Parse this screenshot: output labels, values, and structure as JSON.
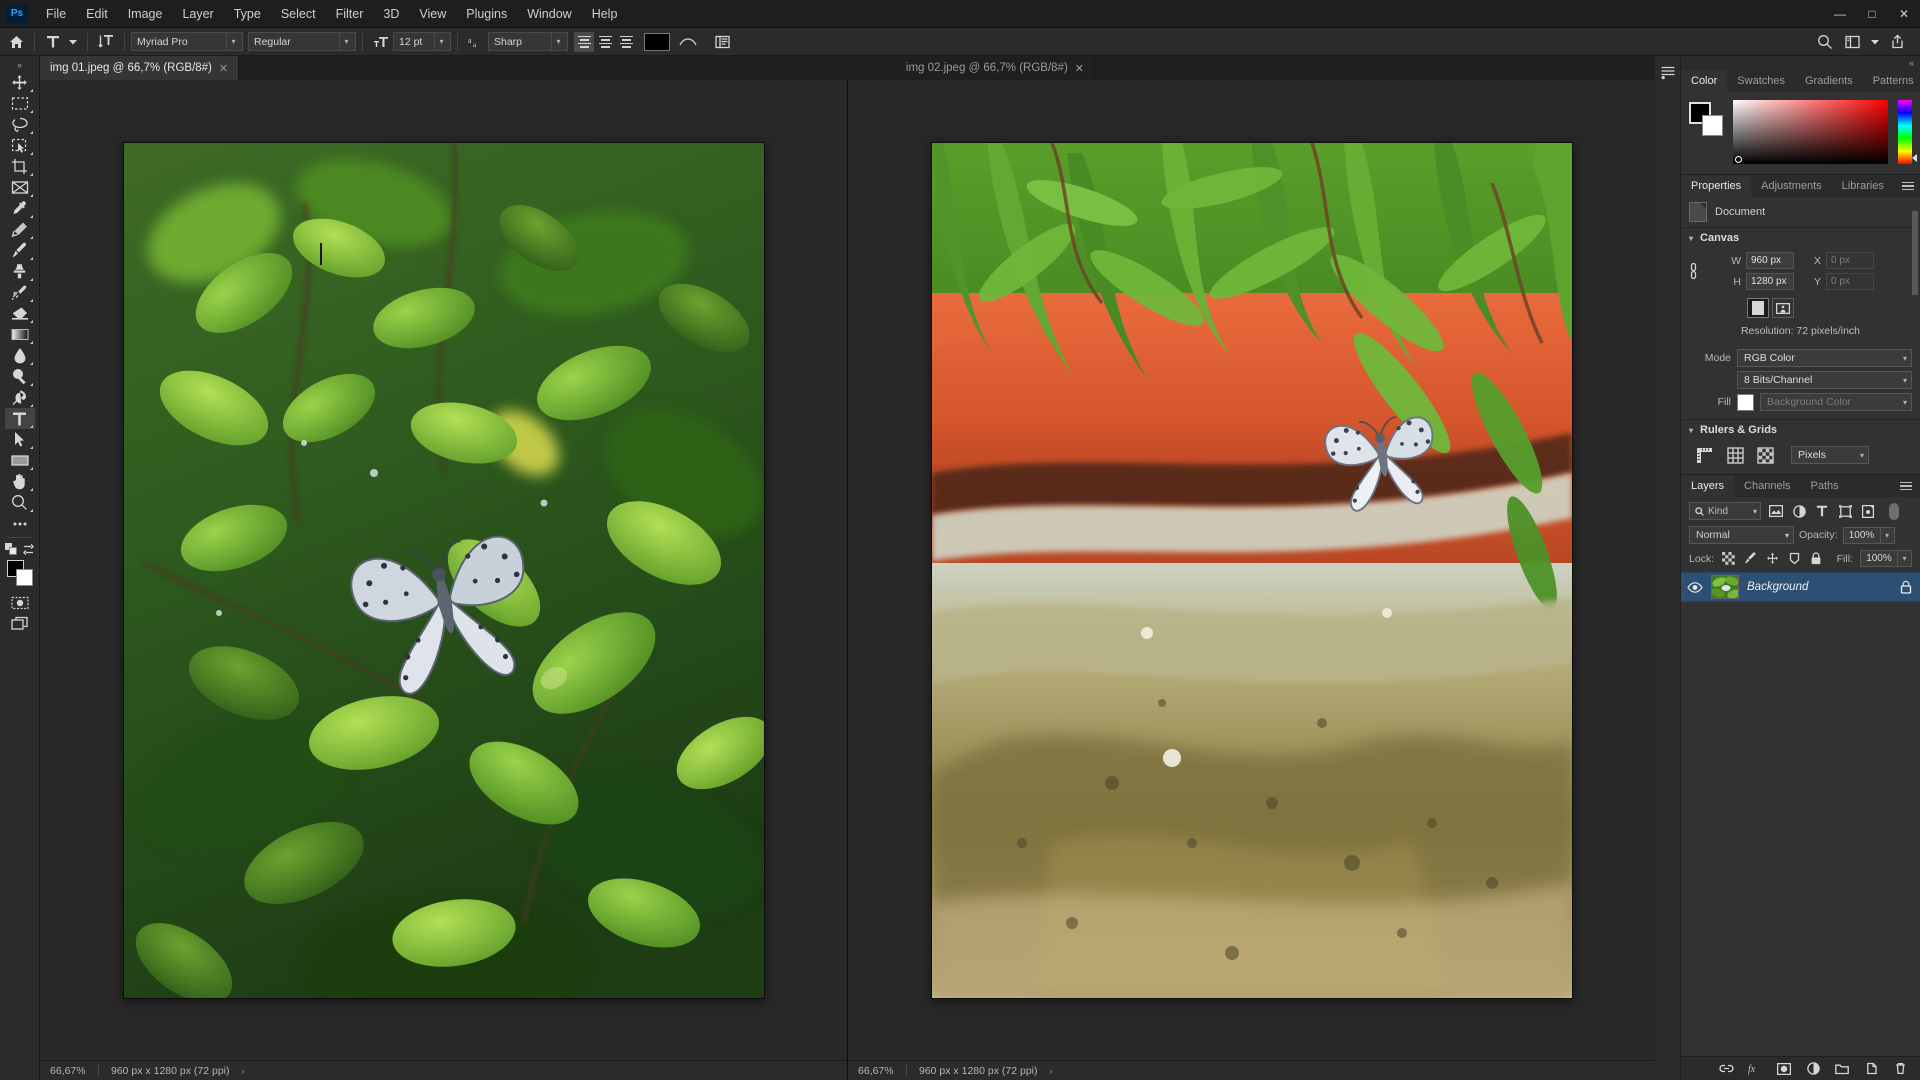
{
  "app": {
    "name": "Ps",
    "logo_text": "Ps"
  },
  "menubar": {
    "items": [
      {
        "label": "File"
      },
      {
        "label": "Edit"
      },
      {
        "label": "Image"
      },
      {
        "label": "Layer"
      },
      {
        "label": "Type"
      },
      {
        "label": "Select"
      },
      {
        "label": "Filter"
      },
      {
        "label": "3D"
      },
      {
        "label": "View"
      },
      {
        "label": "Plugins"
      },
      {
        "label": "Window"
      },
      {
        "label": "Help"
      }
    ]
  },
  "window_controls": {
    "minimize": "—",
    "maximize": "□",
    "close": "✕"
  },
  "options_bar": {
    "home_icon": "home-icon",
    "tool_icon": "type-tool-icon",
    "orientation_icon": "text-orientation-icon",
    "font_family": "Myriad Pro",
    "font_style": "Regular",
    "font_size": "12 pt",
    "antialias_label": "aa",
    "antialias": "Sharp",
    "align": {
      "left": "align-left",
      "center": "align-center",
      "right": "align-right",
      "active": "left"
    },
    "text_color": "#000000",
    "warp_icon": "warp-text-icon",
    "panels_icon": "character-panel-icon",
    "right_icons": [
      "search-icon",
      "workspace-icon",
      "chevron-down-icon",
      "share-icon"
    ]
  },
  "toolbar": {
    "collapse": "»",
    "tools": [
      {
        "name": "move-tool",
        "label": "Move Tool",
        "active": false
      },
      {
        "name": "marquee-tool",
        "label": "Rectangular Marquee Tool",
        "active": false
      },
      {
        "name": "lasso-tool",
        "label": "Lasso Tool",
        "active": false
      },
      {
        "name": "object-selection-tool",
        "label": "Object Selection Tool",
        "active": false
      },
      {
        "name": "crop-tool",
        "label": "Crop Tool",
        "active": false
      },
      {
        "name": "frame-tool",
        "label": "Frame Tool",
        "active": false
      },
      {
        "name": "eyedropper-tool",
        "label": "Eyedropper Tool",
        "active": false
      },
      {
        "name": "healing-brush-tool",
        "label": "Spot Healing Brush Tool",
        "active": false
      },
      {
        "name": "brush-tool",
        "label": "Brush Tool",
        "active": false
      },
      {
        "name": "clone-stamp-tool",
        "label": "Clone Stamp Tool",
        "active": false
      },
      {
        "name": "history-brush-tool",
        "label": "History Brush Tool",
        "active": false
      },
      {
        "name": "eraser-tool",
        "label": "Eraser Tool",
        "active": false
      },
      {
        "name": "gradient-tool",
        "label": "Gradient Tool",
        "active": false
      },
      {
        "name": "blur-tool",
        "label": "Blur Tool",
        "active": false
      },
      {
        "name": "dodge-tool",
        "label": "Dodge Tool",
        "active": false
      },
      {
        "name": "pen-tool",
        "label": "Pen Tool",
        "active": false
      },
      {
        "name": "type-tool",
        "label": "Horizontal Type Tool",
        "active": true
      },
      {
        "name": "path-selection-tool",
        "label": "Path Selection Tool",
        "active": false
      },
      {
        "name": "rectangle-tool",
        "label": "Rectangle Tool",
        "active": false
      },
      {
        "name": "hand-tool",
        "label": "Hand Tool",
        "active": false
      },
      {
        "name": "zoom-tool",
        "label": "Zoom Tool",
        "active": false
      },
      {
        "name": "edit-toolbar",
        "label": "Edit Toolbar",
        "active": false
      }
    ],
    "foreground_color": "#000000",
    "background_color": "#ffffff",
    "quick_mask": "Edit in Quick Mask Mode",
    "screen_mode": "Change Screen Mode"
  },
  "documents": {
    "tabs": [
      {
        "title": "img 01.jpeg @ 66,7% (RGB/8#)",
        "close": "✕",
        "active": true
      },
      {
        "title": "img 02.jpeg @ 66,7% (RGB/8#)",
        "close": "✕",
        "active": false
      }
    ],
    "panes": [
      {
        "name": "document-pane-1",
        "status": {
          "zoom": "66,67%",
          "dimensions": "960 px x 1280 px (72 ppi)",
          "expand": "›"
        }
      },
      {
        "name": "document-pane-2",
        "status": {
          "zoom": "66,67%",
          "dimensions": "960 px x 1280 px (72 ppi)",
          "expand": "›"
        }
      }
    ]
  },
  "color_panel": {
    "tabs": [
      {
        "label": "Color",
        "active": true
      },
      {
        "label": "Swatches",
        "active": false
      },
      {
        "label": "Gradients",
        "active": false
      },
      {
        "label": "Patterns",
        "active": false
      }
    ],
    "foreground": "#000000",
    "background": "#ffffff",
    "menu_icon": "panel-menu-icon"
  },
  "properties_panel": {
    "tabs": [
      {
        "label": "Properties",
        "active": true
      },
      {
        "label": "Adjustments",
        "active": false
      },
      {
        "label": "Libraries",
        "active": false
      }
    ],
    "header": {
      "icon": "document-icon",
      "label": "Document"
    },
    "canvas": {
      "section_label": "Canvas",
      "link_icon": "link-dimensions-icon",
      "w_label": "W",
      "w_value": "960 px",
      "h_label": "H",
      "h_value": "1280 px",
      "x_label": "X",
      "x_value": "0 px",
      "y_label": "Y",
      "y_value": "0 px",
      "orientation_portrait": "portrait-icon",
      "orientation_landscape": "landscape-icon",
      "resolution": "Resolution: 72 pixels/inch",
      "mode_label": "Mode",
      "mode_value": "RGB Color",
      "depth_value": "8 Bits/Channel",
      "fill_label": "Fill",
      "fill_value": "Background Color",
      "fill_swatch": "#ffffff"
    },
    "rulers_grids": {
      "section_label": "Rulers & Grids",
      "rulers_icon": "ruler-icon",
      "grid_icon": "grid-icon",
      "transparency_icon": "checkerboard-icon",
      "units_value": "Pixels"
    }
  },
  "layers_panel": {
    "tabs": [
      {
        "label": "Layers",
        "active": true
      },
      {
        "label": "Channels",
        "active": false
      },
      {
        "label": "Paths",
        "active": false
      }
    ],
    "filter": {
      "search_icon": "search-icon",
      "kind_label": "Kind",
      "icons": [
        "pixel-filter-icon",
        "adjustment-filter-icon",
        "type-filter-icon",
        "shape-filter-icon",
        "smart-object-filter-icon"
      ],
      "toggle": "filter-toggle"
    },
    "blend_mode": "Normal",
    "opacity_label": "Opacity:",
    "opacity_value": "100%",
    "lock_label": "Lock:",
    "lock_icons": [
      "lock-transparent-pixels-icon",
      "lock-image-pixels-icon",
      "lock-position-icon",
      "lock-artboard-icon",
      "lock-all-icon"
    ],
    "fill_label": "Fill:",
    "fill_value": "100%",
    "layers": [
      {
        "name": "Background",
        "visible": true,
        "locked": true,
        "selected": true
      }
    ],
    "footer_icons": [
      "link-layers-icon",
      "layer-style-icon",
      "layer-mask-icon",
      "adjustment-layer-icon",
      "new-group-icon",
      "new-layer-icon",
      "delete-layer-icon"
    ]
  },
  "dock_rail": {
    "collapse": "«",
    "icons": [
      "history-panel-icon"
    ]
  }
}
